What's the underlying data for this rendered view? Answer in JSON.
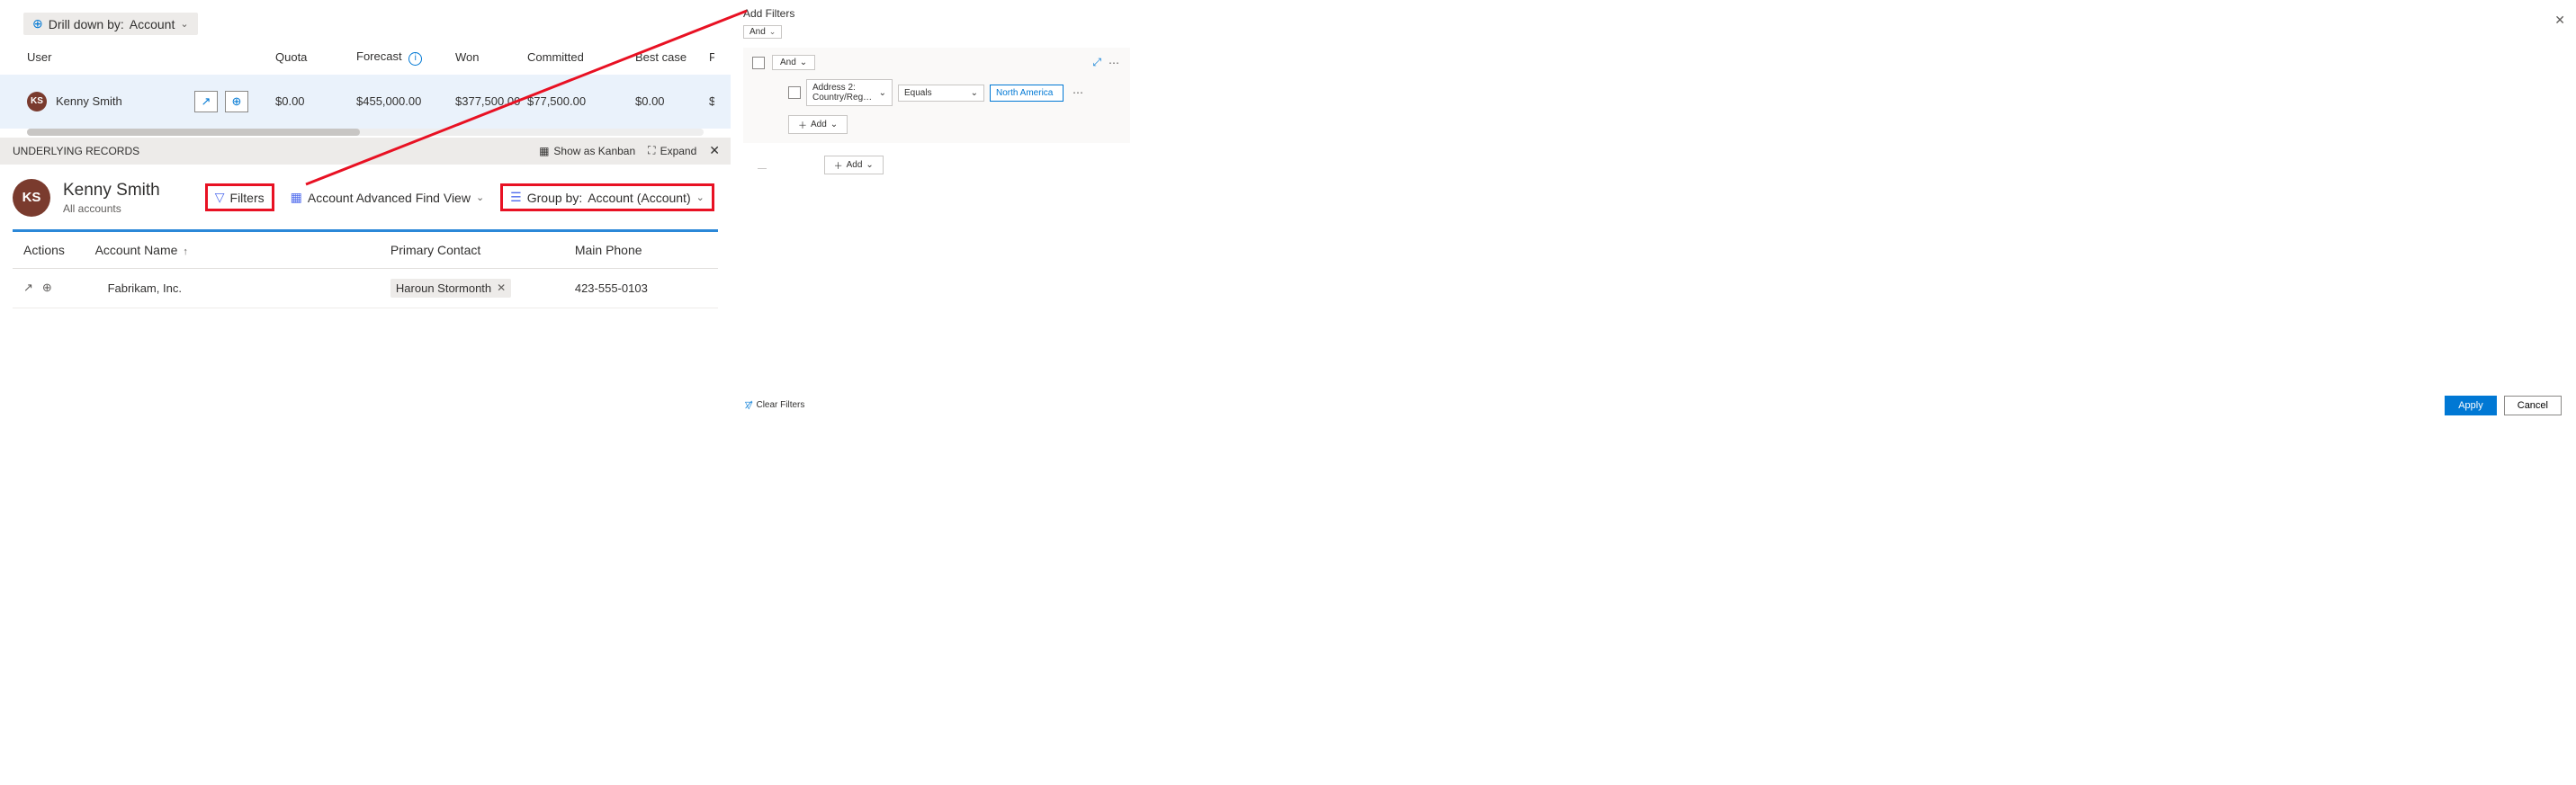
{
  "drilldown": {
    "prefix": "Drill down by:",
    "value": "Account"
  },
  "grid": {
    "headers": {
      "user": "User",
      "quota": "Quota",
      "forecast": "Forecast",
      "won": "Won",
      "committed": "Committed",
      "best": "Best case",
      "pipeline": "P"
    },
    "row": {
      "initials": "KS",
      "name": "Kenny Smith",
      "quota": "$0.00",
      "forecast": "$455,000.00",
      "won": "$377,500.00",
      "committed": "$77,500.00",
      "best": "$0.00",
      "pipeline": "$"
    }
  },
  "records": {
    "title": "UNDERLYING RECORDS",
    "kanban": "Show as Kanban",
    "expand": "Expand"
  },
  "detail": {
    "initials": "KS",
    "title": "Kenny Smith",
    "subtitle": "All accounts",
    "filters": "Filters",
    "view": "Account Advanced Find View",
    "groupby_prefix": "Group by:",
    "groupby_value": "Account (Account)"
  },
  "table": {
    "headers": {
      "actions": "Actions",
      "account": "Account Name",
      "contact": "Primary Contact",
      "phone": "Main Phone"
    },
    "row": {
      "account": "Fabrikam, Inc.",
      "contact": "Haroun Stormonth",
      "phone": "423-555-0103"
    }
  },
  "filters": {
    "title": "Add Filters",
    "root_and": "And",
    "group_and": "And",
    "condition": {
      "field": "Address 2: Country/Reg…",
      "operator": "Equals",
      "value": "North America"
    },
    "add_inner": "Add",
    "add_outer": "Add",
    "clear": "Clear Filters",
    "apply": "Apply",
    "cancel": "Cancel"
  },
  "colors": {
    "accent": "#0078d4",
    "avatar": "#7a3b2e",
    "highlight": "#e81123"
  }
}
